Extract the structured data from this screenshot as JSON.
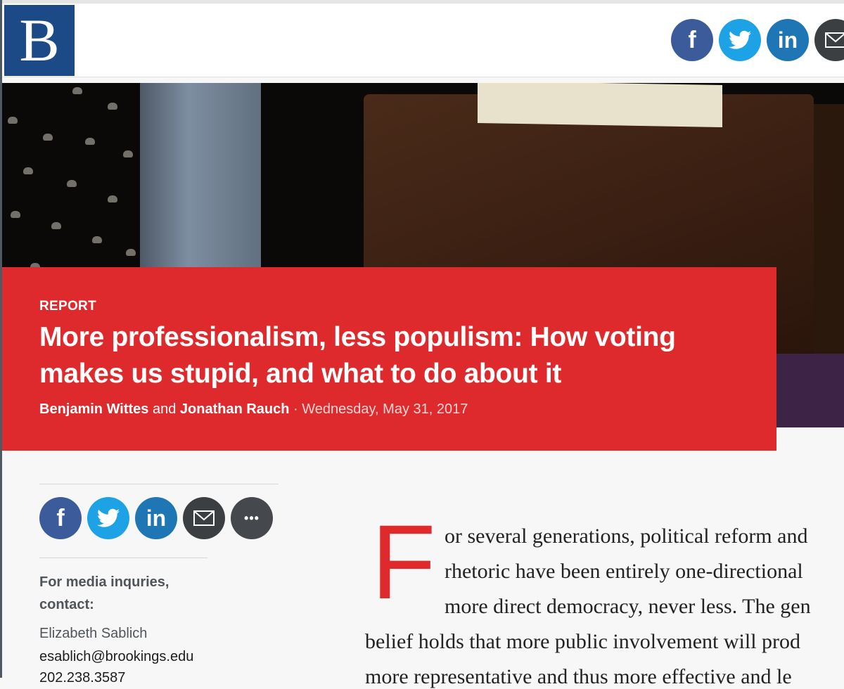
{
  "header": {
    "logo_letter": "B",
    "social": [
      {
        "name": "facebook",
        "glyph": "f"
      },
      {
        "name": "twitter",
        "glyph": "twitter-bird"
      },
      {
        "name": "linkedin",
        "glyph": "in"
      },
      {
        "name": "email",
        "glyph": "envelope"
      }
    ]
  },
  "hero": {
    "kicker": "REPORT",
    "title": "More professionalism, less populism: How voting makes us stupid, and what to do about it",
    "author1": "Benjamin Wittes",
    "and": "and",
    "author2": "Jonathan Rauch",
    "separator": "·",
    "date": "Wednesday, May 31, 2017"
  },
  "sidebar": {
    "share": [
      {
        "name": "facebook",
        "glyph": "f"
      },
      {
        "name": "twitter",
        "glyph": "twitter-bird"
      },
      {
        "name": "linkedin",
        "glyph": "in"
      },
      {
        "name": "email",
        "glyph": "envelope"
      },
      {
        "name": "more",
        "glyph": "•••"
      }
    ],
    "media_label": "For media inquries, contact:",
    "contact_name": "Elizabeth Sablich",
    "contact_email": "esablich@brookings.edu",
    "contact_phone": "202.238.3587"
  },
  "article": {
    "drop_cap": "F",
    "lines": [
      "or several generations, political reform and",
      "rhetoric have been entirely one-directional",
      "more direct democracy, never less. The gen",
      "belief holds that more public involvement will prod",
      "more representative and thus more effective and le"
    ]
  },
  "colors": {
    "brand_blue": "#1c4a87",
    "accent_red": "#de2a2c",
    "facebook": "#3b5b9a",
    "twitter": "#1da2e6",
    "linkedin": "#1e77b4"
  }
}
